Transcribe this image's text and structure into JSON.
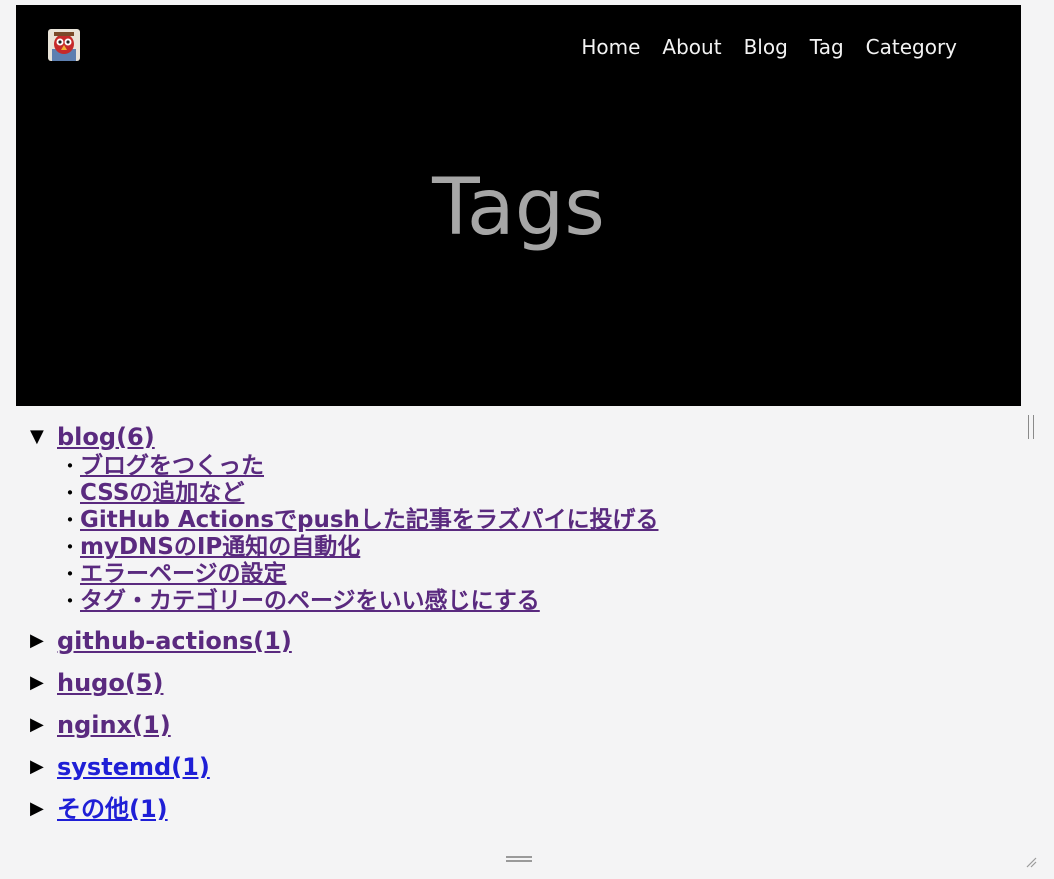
{
  "nav": {
    "links": [
      "Home",
      "About",
      "Blog",
      "Tag",
      "Category"
    ]
  },
  "hero": {
    "title": "Tags"
  },
  "tags": [
    {
      "label": "blog(6)",
      "expanded": true,
      "posts": [
        " ブログをつくった",
        " CSSの追加など",
        " GitHub Actionsでpushした記事をラズパイに投げる",
        " myDNSのIP通知の自動化",
        " エラーページの設定",
        " タグ・カテゴリーのページをいい感じにする"
      ]
    },
    {
      "label": "github-actions(1)",
      "expanded": false
    },
    {
      "label": "hugo(5)",
      "expanded": false
    },
    {
      "label": "nginx(1)",
      "expanded": false
    },
    {
      "label": "systemd(1)",
      "expanded": false
    },
    {
      "label": "その他(1)",
      "expanded": false
    }
  ],
  "markers": {
    "bullet": "・",
    "expanded": "▼",
    "collapsed": "▶"
  },
  "colors": {
    "hero_bg": "#000000",
    "hero_title": "#a6a6a6",
    "visited_link": "#5a2a7f",
    "unvisited_link": "#1f1fd6",
    "page_bg": "#f4f4f5"
  }
}
